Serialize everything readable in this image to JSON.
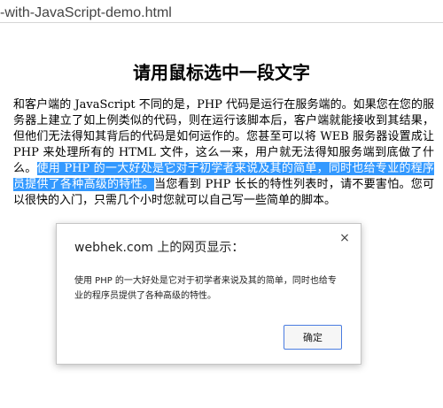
{
  "browser": {
    "url": "-with-JavaScript-demo.html"
  },
  "page": {
    "title": "请用鼠标选中一段文字",
    "paragraph_before": "和客户端的 JavaScript 不同的是，PHP 代码是运行在服务端的。如果您在您的服务器上建立了如上例类似的代码，则在运行该脚本后，客户端就能接收到其结果，但他们无法得知其背后的代码是如何运作的。您甚至可以将 WEB 服务器设置成让 PHP 来处理所有的 HTML 文件，这么一来，用户就无法得知服务端到底做了什么。",
    "paragraph_selected": "使用 PHP 的一大好处是它对于初学者来说及其的简单，同时也给专业的程序员提供了各种高级的特性。",
    "paragraph_after": "当您看到 PHP 长长的特性列表时，请不要害怕。您可以很快的入门，只需几个小时您就可以自己写一些简单的脚本。"
  },
  "dialog": {
    "title": "webhek.com 上的网页显示：",
    "close_symbol": "×",
    "message": "使用 PHP 的一大好处是它对于初学者来说及其的简单，同时也给专业的程序员提供了各种高级的特性。",
    "ok_label": "确定",
    "accent_color": "#4a7ce0"
  },
  "colors": {
    "selection_background": "#3399ff",
    "selection_text": "#ffffff"
  }
}
